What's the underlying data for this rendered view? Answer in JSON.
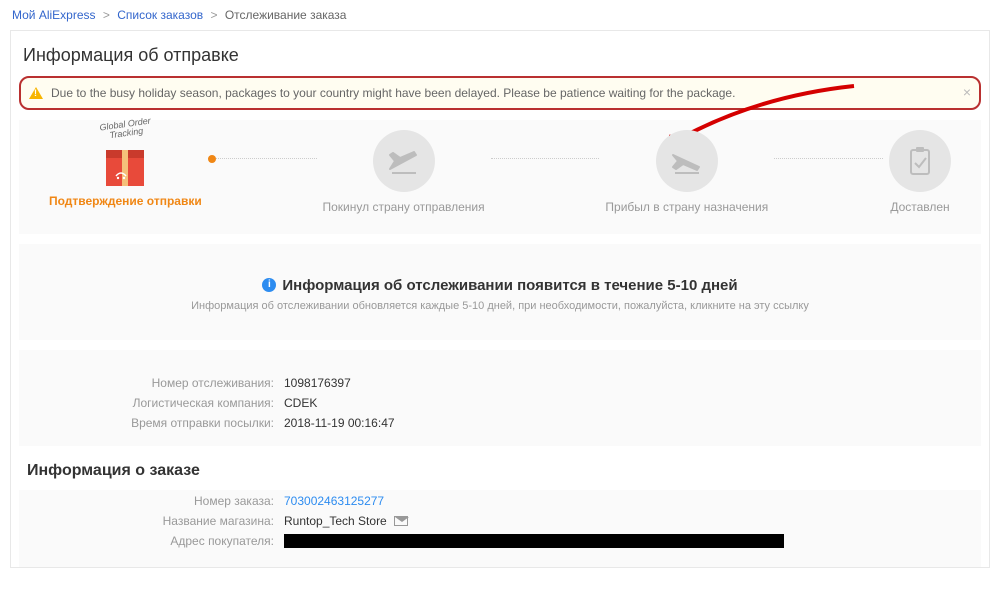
{
  "breadcrumb": {
    "item1": "Мой AliExpress",
    "item2": "Список заказов",
    "item3": "Отслеживание заказа"
  },
  "page_title": "Информация об отправке",
  "alert": {
    "text": "Due to the busy holiday season, packages to your country might have been delayed. Please be patience waiting for the package."
  },
  "steps": {
    "box_ribbon_l1": "Global Order",
    "box_ribbon_l2": "Tracking",
    "s1": "Подтверждение отправки",
    "s2": "Покинул страну отправления",
    "s3": "Прибыл в страну назначения",
    "s4": "Доставлен"
  },
  "info": {
    "headline": "Информация об отслеживании появится в течение 5-10 дней",
    "subline": "Информация об отслеживании обновляется каждые 5-10 дней, при необходимости, пожалуйста, кликните на эту ссылку"
  },
  "shipment": {
    "tracking_label": "Номер отслеживания:",
    "tracking_value": "1098176397",
    "carrier_label": "Логистическая компания:",
    "carrier_value": "CDEK",
    "sent_label": "Время отправки посылки:",
    "sent_value": "2018-11-19 00:16:47"
  },
  "order_section_title": "Информация о заказе",
  "order": {
    "number_label": "Номер заказа:",
    "number_value": "703002463125277",
    "store_label": "Название магазина:",
    "store_value": "Runtop_Tech Store",
    "address_label": "Адрес покупателя:"
  }
}
